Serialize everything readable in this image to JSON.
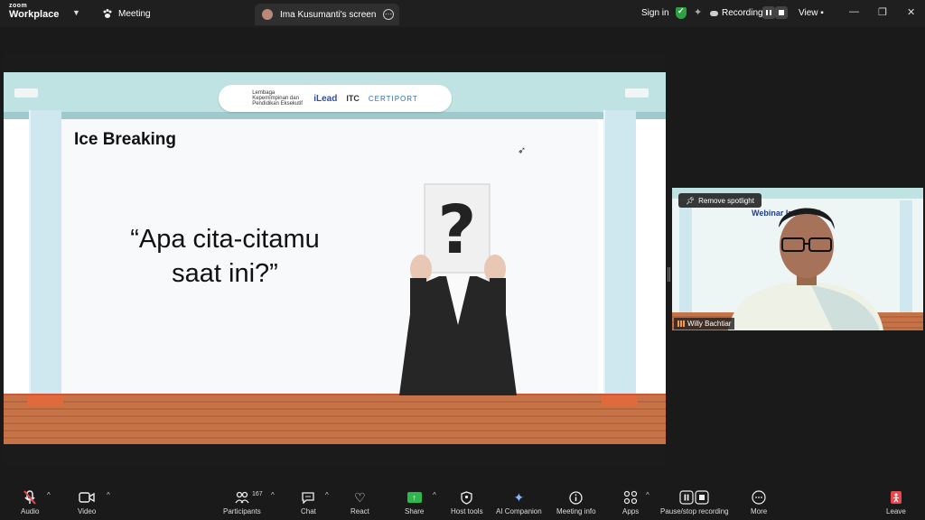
{
  "title_bar": {
    "brand_zoom": "zoom",
    "brand_workplace": "Workplace",
    "meeting_label": "Meeting",
    "screen_tab_label": "Ima Kusumanti's screen",
    "sign_in": "Sign in",
    "recording_label": "Recording...",
    "view_label": "View"
  },
  "slide": {
    "title": "Ice Breaking",
    "quote_line1": "“Apa cita-citamu",
    "quote_line2": "saat ini?”",
    "logo_lembaga": "Lembaga Kepemimpinan dan Pendidikan Eksekutif",
    "logo_ilead": "iLead",
    "logo_itc": "ITC",
    "logo_certiport": "CERTIPORT"
  },
  "video": {
    "remove_spotlight": "Remove spotlight",
    "participant_name": "Willy Bachtiar",
    "bg_title": "Webinar Inspiratif"
  },
  "toolbar": {
    "audio": "Audio",
    "video": "Video",
    "participants": "Participants",
    "participants_count": "167",
    "chat": "Chat",
    "react": "React",
    "share": "Share",
    "host_tools": "Host tools",
    "ai_companion": "AI Companion",
    "meeting_info": "Meeting info",
    "apps": "Apps",
    "pause_stop": "Pause/stop recording",
    "more": "More",
    "leave": "Leave"
  },
  "colors": {
    "share_green": "#2db84d",
    "shield_green": "#2ea043",
    "leave_red": "#e5484d",
    "slide_floor": "#c77348",
    "slide_sky": "#bfe3e3"
  }
}
